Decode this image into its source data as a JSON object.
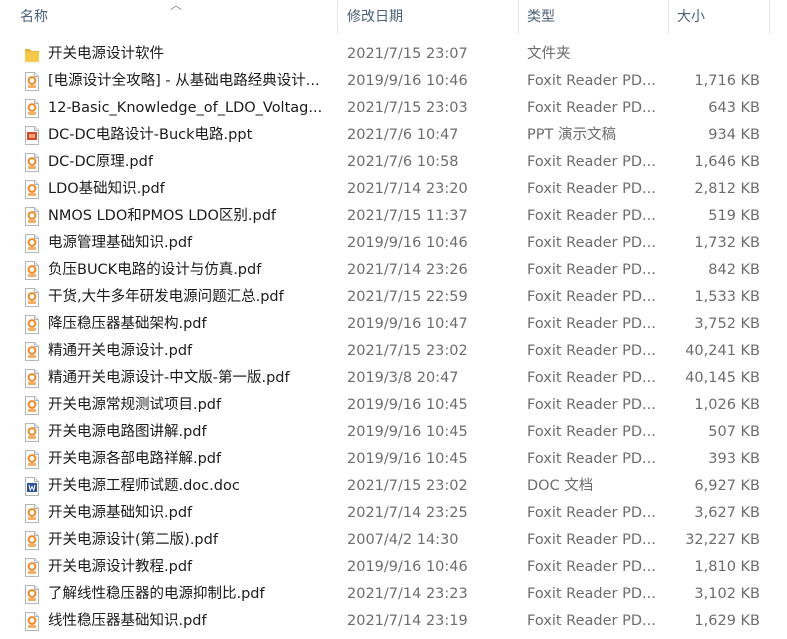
{
  "columns": {
    "name": "名称",
    "date": "修改日期",
    "type": "类型",
    "size": "大小"
  },
  "files": [
    {
      "name": "开关电源设计软件",
      "date": "2021/7/15 23:07",
      "type": "文件夹",
      "size": "",
      "icon": "folder-icon"
    },
    {
      "name": "[电源设计全攻略] - 从基础电路经典设计...",
      "date": "2019/9/16 10:46",
      "type": "Foxit Reader PD...",
      "size": "1,716 KB",
      "icon": "pdf-icon"
    },
    {
      "name": "12-Basic_Knowledge_of_LDO_Voltag...",
      "date": "2021/7/15 23:03",
      "type": "Foxit Reader PD...",
      "size": "643 KB",
      "icon": "pdf-icon"
    },
    {
      "name": "DC-DC电路设计-Buck电路.ppt",
      "date": "2021/7/6 10:47",
      "type": "PPT 演示文稿",
      "size": "934 KB",
      "icon": "ppt-icon"
    },
    {
      "name": "DC-DC原理.pdf",
      "date": "2021/7/6 10:58",
      "type": "Foxit Reader PD...",
      "size": "1,646 KB",
      "icon": "pdf-icon"
    },
    {
      "name": "LDO基础知识.pdf",
      "date": "2021/7/14 23:20",
      "type": "Foxit Reader PD...",
      "size": "2,812 KB",
      "icon": "pdf-icon"
    },
    {
      "name": "NMOS LDO和PMOS LDO区别.pdf",
      "date": "2021/7/15 11:37",
      "type": "Foxit Reader PD...",
      "size": "519 KB",
      "icon": "pdf-icon"
    },
    {
      "name": "电源管理基础知识.pdf",
      "date": "2019/9/16 10:46",
      "type": "Foxit Reader PD...",
      "size": "1,732 KB",
      "icon": "pdf-icon"
    },
    {
      "name": "负压BUCK电路的设计与仿真.pdf",
      "date": "2021/7/14 23:26",
      "type": "Foxit Reader PD...",
      "size": "842 KB",
      "icon": "pdf-icon"
    },
    {
      "name": "干货,大牛多年研发电源问题汇总.pdf",
      "date": "2021/7/15 22:59",
      "type": "Foxit Reader PD...",
      "size": "1,533 KB",
      "icon": "pdf-icon"
    },
    {
      "name": "降压稳压器基础架构.pdf",
      "date": "2019/9/16 10:47",
      "type": "Foxit Reader PD...",
      "size": "3,752 KB",
      "icon": "pdf-icon"
    },
    {
      "name": "精通开关电源设计.pdf",
      "date": "2021/7/15 23:02",
      "type": "Foxit Reader PD...",
      "size": "40,241 KB",
      "icon": "pdf-icon"
    },
    {
      "name": "精通开关电源设计-中文版-第一版.pdf",
      "date": "2019/3/8 20:47",
      "type": "Foxit Reader PD...",
      "size": "40,145 KB",
      "icon": "pdf-icon"
    },
    {
      "name": "开关电源常规测试项目.pdf",
      "date": "2019/9/16 10:45",
      "type": "Foxit Reader PD...",
      "size": "1,026 KB",
      "icon": "pdf-icon"
    },
    {
      "name": "开关电源电路图讲解.pdf",
      "date": "2019/9/16 10:45",
      "type": "Foxit Reader PD...",
      "size": "507 KB",
      "icon": "pdf-icon"
    },
    {
      "name": "开关电源各部电路祥解.pdf",
      "date": "2019/9/16 10:45",
      "type": "Foxit Reader PD...",
      "size": "393 KB",
      "icon": "pdf-icon"
    },
    {
      "name": "开关电源工程师试题.doc.doc",
      "date": "2021/7/15 23:02",
      "type": "DOC 文档",
      "size": "6,927 KB",
      "icon": "doc-icon"
    },
    {
      "name": "开关电源基础知识.pdf",
      "date": "2021/7/14 23:25",
      "type": "Foxit Reader PD...",
      "size": "3,627 KB",
      "icon": "pdf-icon"
    },
    {
      "name": "开关电源设计(第二版).pdf",
      "date": "2007/4/2 14:30",
      "type": "Foxit Reader PD...",
      "size": "32,227 KB",
      "icon": "pdf-icon"
    },
    {
      "name": "开关电源设计教程.pdf",
      "date": "2019/9/16 10:46",
      "type": "Foxit Reader PD...",
      "size": "1,810 KB",
      "icon": "pdf-icon"
    },
    {
      "name": "了解线性稳压器的电源抑制比.pdf",
      "date": "2021/7/14 23:23",
      "type": "Foxit Reader PD...",
      "size": "3,102 KB",
      "icon": "pdf-icon"
    },
    {
      "name": "线性稳压器基础知识.pdf",
      "date": "2021/7/14 23:19",
      "type": "Foxit Reader PD...",
      "size": "1,629 KB",
      "icon": "pdf-icon"
    }
  ],
  "colors": {
    "header_text": "#4c607a",
    "meta_text": "#6d6d6d",
    "folder": "#f6c94a",
    "pdf_accent": "#f08a22",
    "ppt_accent": "#d24726",
    "doc_accent": "#2b579a"
  }
}
